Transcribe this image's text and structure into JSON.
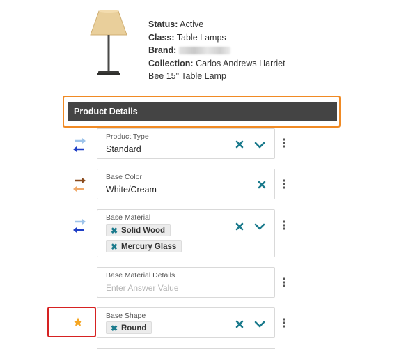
{
  "product": {
    "status_label": "Status:",
    "status_value": "Active",
    "class_label": "Class:",
    "class_value": "Table Lamps",
    "brand_label": "Brand:",
    "collection_label": "Collection:",
    "collection_value_line1": "Carlos Andrews Harriet",
    "collection_value_line2": "Bee 15\" Table Lamp"
  },
  "section": {
    "title": "Product Details"
  },
  "fields": {
    "product_type": {
      "label": "Product Type",
      "value": "Standard"
    },
    "base_color": {
      "label": "Base Color",
      "value": "White/Cream"
    },
    "base_material": {
      "label": "Base Material",
      "chips": [
        "Solid Wood",
        "Mercury Glass"
      ]
    },
    "base_material_details": {
      "label": "Base Material Details",
      "placeholder": "Enter Answer Value"
    },
    "base_shape": {
      "label": "Base Shape",
      "chips": [
        "Round"
      ]
    }
  },
  "colors": {
    "accent_teal": "#1a7a8c",
    "header_bg": "#444444",
    "highlight_orange": "#f08a24",
    "highlight_red": "#d62222",
    "star_gold": "#f5a623",
    "arrow_light_blue": "#9dc3ea",
    "arrow_blue": "#1f3fc6",
    "arrow_brown": "#8a4a1c",
    "arrow_orange": "#f0a868"
  },
  "icons": {
    "clear": "close-icon",
    "dropdown": "chevron-down-icon",
    "more": "kebab-icon",
    "sync": "sync-arrows-icon",
    "required": "star-icon"
  }
}
